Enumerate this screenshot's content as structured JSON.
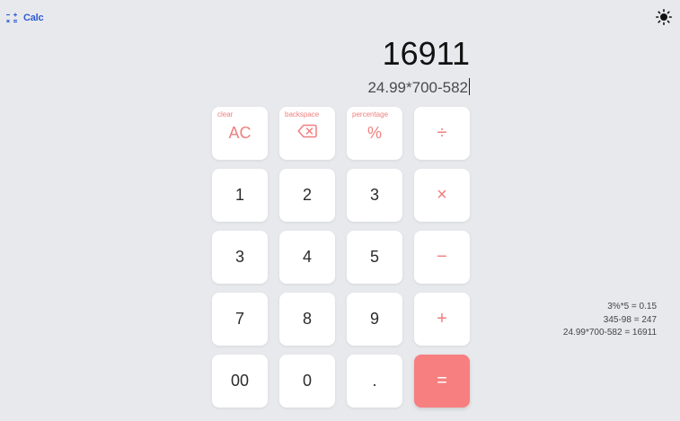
{
  "header": {
    "logo_icon": "calculator-icon",
    "app_name": "Calc",
    "theme_icon": "sun-icon"
  },
  "display": {
    "result": "16911",
    "expression": "24.99*700-582"
  },
  "keypad": {
    "clear": {
      "hint": "clear",
      "label": "AC"
    },
    "backspace": {
      "hint": "backspace",
      "icon": "backspace-icon"
    },
    "percentage": {
      "hint": "percentage",
      "label": "%"
    },
    "divide": "÷",
    "multiply": "×",
    "minus": "−",
    "plus": "+",
    "equals": "=",
    "digits": {
      "r2": [
        "1",
        "2",
        "3"
      ],
      "r3": [
        "3",
        "4",
        "5"
      ],
      "r4": [
        "7",
        "8",
        "9"
      ],
      "r5": [
        "00",
        "0",
        "."
      ]
    }
  },
  "history": [
    "3%*5 = 0.15",
    "345-98 = 247",
    "24.99*700-582 = 16911"
  ],
  "colors": {
    "accent": "#f77f7f",
    "brand": "#2d5bd6",
    "background": "#e8e9ed"
  }
}
